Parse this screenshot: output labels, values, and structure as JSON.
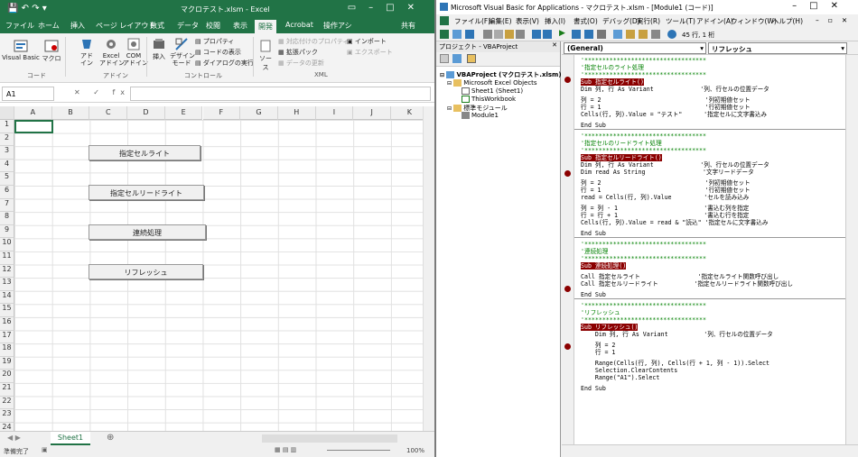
{
  "excel": {
    "title": "マクロテスト.xlsm - Excel",
    "tabs": [
      "ファイル",
      "ホーム",
      "挿入",
      "ページ レイアウト",
      "数式",
      "データ",
      "校閲",
      "表示",
      "開発",
      "Acrobat",
      "操作アシ",
      "共有"
    ],
    "active_tab": "開発",
    "ribbon": {
      "visual_basic": "Visual Basic",
      "macro": "マクロ",
      "addin": "アド\nイン",
      "excel_addin": "Excel\nアドイン",
      "com_addin": "COM\nアドイン",
      "insert": "挿入",
      "design_mode": "デザイン\nモード",
      "properties": "プロパティ",
      "view_code": "コードの表示",
      "run_dialog": "ダイアログの実行",
      "source": "ソース",
      "map_props": "対応付けのプロパティ",
      "expansion_pack": "拡張パック",
      "refresh_data": "データの更新",
      "import": "インポート",
      "export": "エクスポート",
      "group_code": "コード",
      "group_addin": "アドイン",
      "group_control": "コントロール",
      "group_xml": "XML"
    },
    "name_box": "A1",
    "fx_icons": "✕ ✓ fx",
    "columns": [
      "A",
      "B",
      "C",
      "D",
      "E",
      "F",
      "G",
      "H",
      "I",
      "J",
      "K"
    ],
    "rows": [
      "1",
      "2",
      "3",
      "4",
      "5",
      "6",
      "7",
      "8",
      "9",
      "10",
      "11",
      "12",
      "13",
      "14",
      "15",
      "16",
      "17",
      "18",
      "19",
      "20",
      "21",
      "22",
      "23",
      "24"
    ],
    "buttons": [
      "指定セルライト",
      "指定セルリードライト",
      "連続処理",
      "リフレッシュ"
    ],
    "sheet_tab": "Sheet1",
    "status_left": "準備完了",
    "zoom": "100%"
  },
  "vba": {
    "title": "Microsoft Visual Basic for Applications - マクロテスト.xlsm - [Module1 (コード)]",
    "menus": [
      "ファイル(F)",
      "編集(E)",
      "表示(V)",
      "挿入(I)",
      "書式(O)",
      "デバッグ(D)",
      "実行(R)",
      "ツール(T)",
      "アドイン(A)",
      "ウィンドウ(W)",
      "ヘルプ(H)"
    ],
    "position": "45 行, 1 桁",
    "project_title": "プロジェクト - VBAProject",
    "tree": [
      "VBAProject (マクロテスト.xlsm)",
      "Microsoft Excel Objects",
      "Sheet1 (Sheet1)",
      "ThisWorkbook",
      "標準モジュール",
      "Module1"
    ],
    "combo_left": "(General)",
    "combo_right": "リフレッシュ",
    "code": [
      "'**********************************",
      "'指定セルのライト処理",
      "'**********************************",
      "Sub 指定セルライト()",
      "Dim 列, 行 As Variant             '列、行セルの位置データ",
      "",
      "列 = 2                             '列初期値セット",
      "行 = 1                             '行初期値セット",
      "Cells(行, 列).Value = \"テスト\"      '指定セルに文字書込み",
      "",
      "End Sub",
      "",
      "'**********************************",
      "'指定セルのリードライト処理",
      "'**********************************",
      "Sub 指定セルリードライト()",
      "Dim 列, 行 As Variant             '列、行セルの位置データ",
      "Dim read As String                '文字リードデータ",
      "",
      "列 = 2                             '列初期値セット",
      "行 = 1                             '行初期値セット",
      "read = Cells(行, 列).Value         'セルを読み込み",
      "",
      "列 = 列 - 1                        '書込む列を指定",
      "行 = 行 + 1                        '書込む行を指定",
      "Cells(行, 列).Value = read & \"読込\" '指定セルに文字書込み",
      "",
      "End Sub",
      "",
      "'**********************************",
      "'連続処理",
      "'**********************************",
      "Sub 連続処理()",
      "",
      "Call 指定セルライト                '指定セルライト関数呼び出し",
      "Call 指定セルリードライト          '指定セルリードライト関数呼び出し",
      "",
      "End Sub",
      "",
      "'**********************************",
      "'リフレッシュ",
      "'**********************************",
      "Sub リフレッシュ()",
      "    Dim 列, 行 As Variant          '列、行セルの位置データ",
      "",
      "    列 = 2",
      "    行 = 1",
      "",
      "    Range(Cells(行, 列), Cells(行 + 1, 列 - 1)).Select",
      "    Selection.ClearContents",
      "    Range(\"A1\").Select",
      "",
      "End Sub"
    ]
  }
}
